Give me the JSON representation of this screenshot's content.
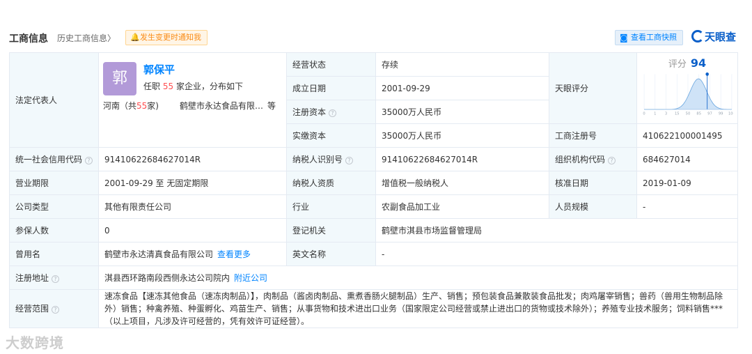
{
  "header": {
    "title": "工商信息",
    "history": "历史工商信息",
    "history_chevron": "〉",
    "notify_label": "发生变更时通知我",
    "snapshot_label": "查看工商快照",
    "brand": "天眼查"
  },
  "legal_rep": {
    "label": "法定代表人",
    "avatar_char": "郭",
    "name": "郭保平",
    "desc_prefix": "任职",
    "desc_count": "55",
    "desc_suffix": "家企业，分布如下",
    "region_prefix": "河南（共",
    "region_count": "55",
    "region_suffix": "家)",
    "region_company": "鹤壁市永达食品有限…",
    "region_etc": "等"
  },
  "status": {
    "label": "经营状态",
    "value": "存续"
  },
  "founded": {
    "label": "成立日期",
    "value": "2001-09-29"
  },
  "reg_capital": {
    "label": "注册资本",
    "value": "35000万人民币"
  },
  "paid_capital": {
    "label": "实缴资本",
    "value": "35000万人民币"
  },
  "score": {
    "label": "天眼评分",
    "head": "评分",
    "value": "94",
    "ticks": [
      "0",
      "1",
      "3",
      "15",
      "50",
      "85",
      "97",
      "99",
      "100"
    ],
    "accent": "#0a5fc9"
  },
  "reg_no": {
    "label": "工商注册号",
    "value": "410622100001495"
  },
  "credit_code": {
    "label": "统一社会信用代码",
    "value": "91410622684627014R"
  },
  "taxpayer_id": {
    "label": "纳税人识别号",
    "value": "91410622684627014R"
  },
  "org_code": {
    "label": "组织机构代码",
    "value": "684627014"
  },
  "term": {
    "label": "营业期限",
    "value": "2001-09-29 至 无固定期限"
  },
  "taxpayer_qual": {
    "label": "纳税人资质",
    "value": "增值税一般纳税人"
  },
  "approval_date": {
    "label": "核准日期",
    "value": "2019-01-09"
  },
  "company_type": {
    "label": "公司类型",
    "value": "其他有限责任公司"
  },
  "industry": {
    "label": "行业",
    "value": "农副食品加工业"
  },
  "staff_size": {
    "label": "人员规模",
    "value": "-"
  },
  "insured": {
    "label": "参保人数",
    "value": "0"
  },
  "reg_authority": {
    "label": "登记机关",
    "value": "鹤壁市淇县市场监督管理局"
  },
  "former_name": {
    "label": "曾用名",
    "value": "鹤壁市永达清真食品有限公司",
    "link": "查看更多"
  },
  "english_name": {
    "label": "英文名称",
    "value": "-"
  },
  "address": {
    "label": "注册地址",
    "value": "淇县西环路南段西侧永达公司院内",
    "link": "附近公司"
  },
  "scope": {
    "label": "经营范围",
    "value": "速冻食品【速冻其他食品（速冻肉制品）】，肉制品（酱卤肉制品、熏煮香肠火腿制品）生产、销售；预包装食品兼散装食品批发；肉鸡屠宰销售；兽药（兽用生物制品除外）销售；种禽养殖、种蛋孵化、鸡苗生产、销售；从事货物和技术进出口业务（国家限定公司经营或禁止进出口的货物或技术除外）；养殖专业技术服务；饲料销售***（以上项目，凡涉及许可经营的，凭有效许可证经营）。"
  },
  "watermark": "大数跨境"
}
